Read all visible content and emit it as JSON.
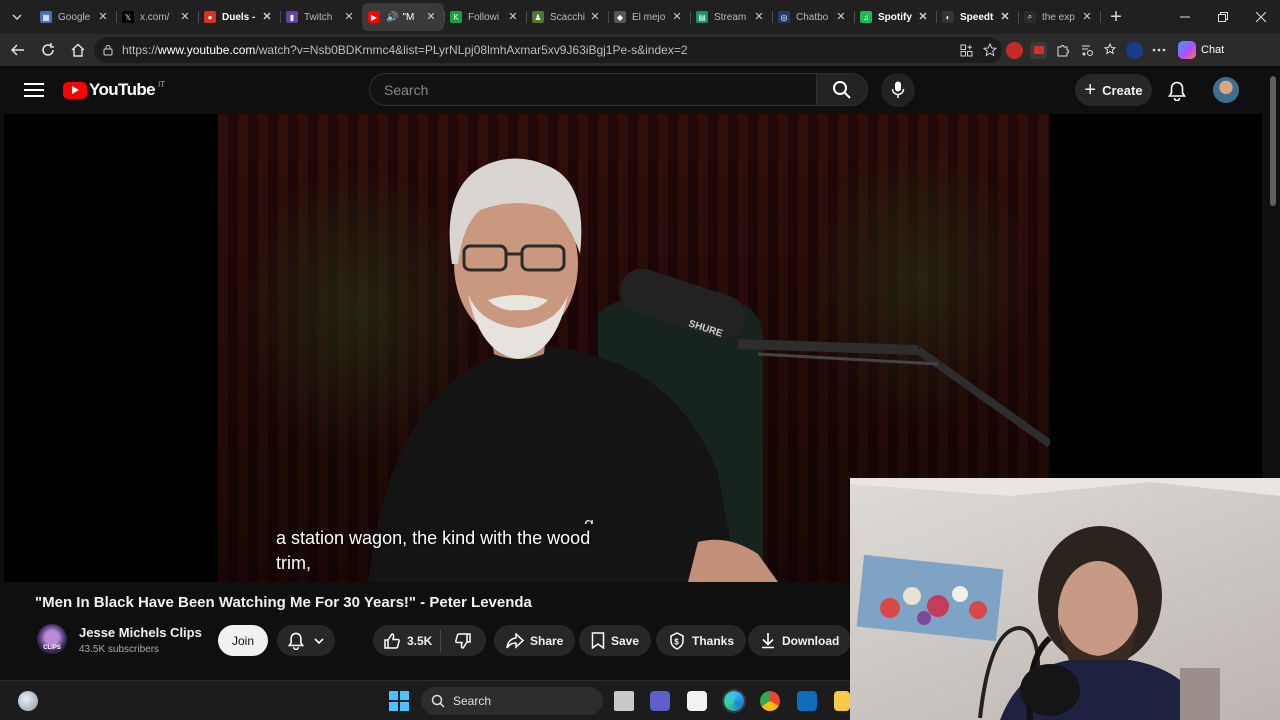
{
  "browser": {
    "tabs": [
      {
        "label": "Google",
        "fav_color": "#4a6fb5",
        "fav_glyph": "▦"
      },
      {
        "label": "x.com/",
        "fav_color": "#000000",
        "fav_glyph": "𝕏"
      },
      {
        "label": "Duels -",
        "fav_color": "#d93025",
        "fav_glyph": "●",
        "bold": true
      },
      {
        "label": "Twitch",
        "fav_color": "#6441a5",
        "fav_glyph": "▮"
      },
      {
        "label": "\"M",
        "fav_color": "#ff0000",
        "fav_glyph": "▶",
        "active": true,
        "audio": "🔊"
      },
      {
        "label": "Followi",
        "fav_color": "#1a9e3f",
        "fav_glyph": "K"
      },
      {
        "label": "Scacchi",
        "fav_color": "#4a7a2a",
        "fav_glyph": "♟"
      },
      {
        "label": "El mejo",
        "fav_color": "#555555",
        "fav_glyph": "◆"
      },
      {
        "label": "Stream",
        "fav_color": "#1f8f6a",
        "fav_glyph": "▤"
      },
      {
        "label": "Chatbo",
        "fav_color": "#2a3a6a",
        "fav_glyph": "◎"
      },
      {
        "label": "Spotify",
        "fav_color": "#1db954",
        "fav_glyph": "♫",
        "bold": true
      },
      {
        "label": "Speedt",
        "fav_color": "#333333",
        "fav_glyph": "◐",
        "bold": true
      },
      {
        "label": "the exp",
        "fav_color": "#2b2b2b",
        "fav_glyph": "⌕"
      }
    ],
    "new_tab_glyph": "+",
    "url_prefix": "https://",
    "url_host": "www.youtube.com",
    "url_path": "/watch?v=Nsb0BDKmmc4&list=PLyrNLpj08lmhAxmar5xv9J63iBgj1Pe-s&index=2",
    "chat_label": "Chat"
  },
  "youtube": {
    "logo_word": "YouTube",
    "country_code": "IT",
    "search_placeholder": "Search",
    "create_label": "Create",
    "video": {
      "subtitle_line1": "a station wagon, the kind with the wood",
      "subtitle_line2": "trim,",
      "subtitle_ghost": "g ,"
    },
    "title": "\"Men In Black Have Been Watching Me For 30 Years!\" - Peter Levenda",
    "channel": {
      "name": "Jesse Michels Clips",
      "subscribers": "43.5K subscribers",
      "avatar_text": "CLIPS"
    },
    "join_label": "Join",
    "like_count": "3.5K",
    "share_label": "Share",
    "save_label": "Save",
    "thanks_label": "Thanks",
    "download_label": "Download"
  },
  "taskbar": {
    "search_label": "Search"
  },
  "colors": {
    "yt_red": "#ff0000",
    "bg": "#0f0f0f",
    "pill_bg": "#272727",
    "win_blue": "#4cc2ff"
  }
}
